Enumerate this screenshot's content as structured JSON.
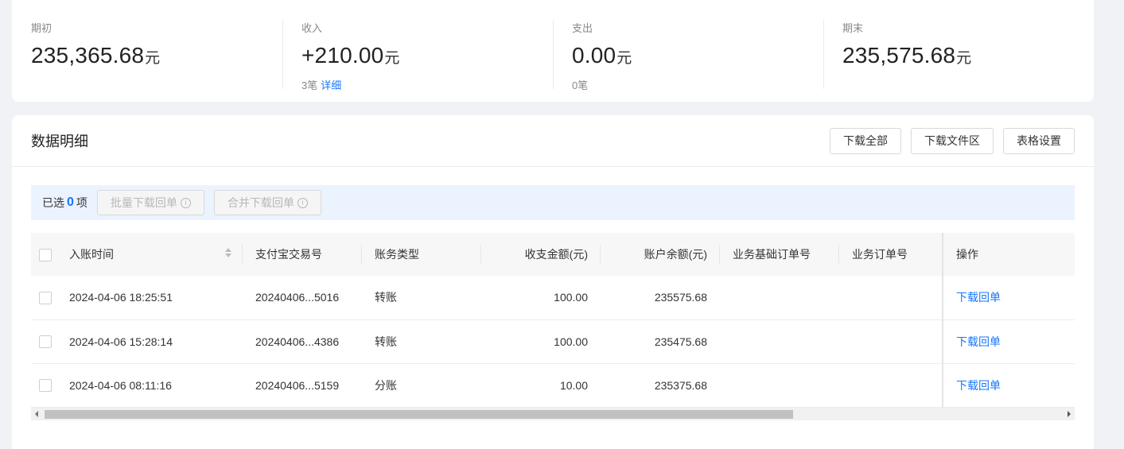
{
  "summary": {
    "opening": {
      "label": "期初",
      "value": "235,365.68",
      "unit": "元"
    },
    "income": {
      "label": "收入",
      "value": "+210.00",
      "unit": "元",
      "count": "3笔",
      "detail_link": "详细"
    },
    "expense": {
      "label": "支出",
      "value": "0.00",
      "unit": "元",
      "count": "0笔"
    },
    "closing": {
      "label": "期末",
      "value": "235,575.68",
      "unit": "元"
    }
  },
  "detail": {
    "title": "数据明细",
    "actions": {
      "download_all": "下载全部",
      "download_files": "下载文件区",
      "table_settings": "表格设置"
    },
    "selection": {
      "prefix": "已选",
      "count": "0",
      "suffix": "项",
      "batch_download": "批量下载回单",
      "merge_download": "合并下载回单"
    },
    "columns": {
      "time": "入账时间",
      "alipay_no": "支付宝交易号",
      "type": "账务类型",
      "amount": "收支金额(元)",
      "balance": "账户余额(元)",
      "base_order": "业务基础订单号",
      "order": "业务订单号",
      "action": "操作"
    },
    "rows": [
      {
        "time": "2024-04-06 18:25:51",
        "alipay_no": "20240406...5016",
        "type": "转账",
        "amount": "100.00",
        "balance": "235575.68",
        "base_order": "",
        "order": "",
        "action": "下载回单"
      },
      {
        "time": "2024-04-06 15:28:14",
        "alipay_no": "20240406...4386",
        "type": "转账",
        "amount": "100.00",
        "balance": "235475.68",
        "base_order": "",
        "order": "",
        "action": "下载回单"
      },
      {
        "time": "2024-04-06 08:11:16",
        "alipay_no": "20240406...5159",
        "type": "分账",
        "amount": "10.00",
        "balance": "235375.68",
        "base_order": "",
        "order": "",
        "action": "下载回单"
      }
    ]
  },
  "colors": {
    "accent": "#1677ff",
    "selection_bg": "#ebf3ff"
  },
  "icons": {
    "info": "info-circle-icon",
    "sort": "sort-icon"
  }
}
